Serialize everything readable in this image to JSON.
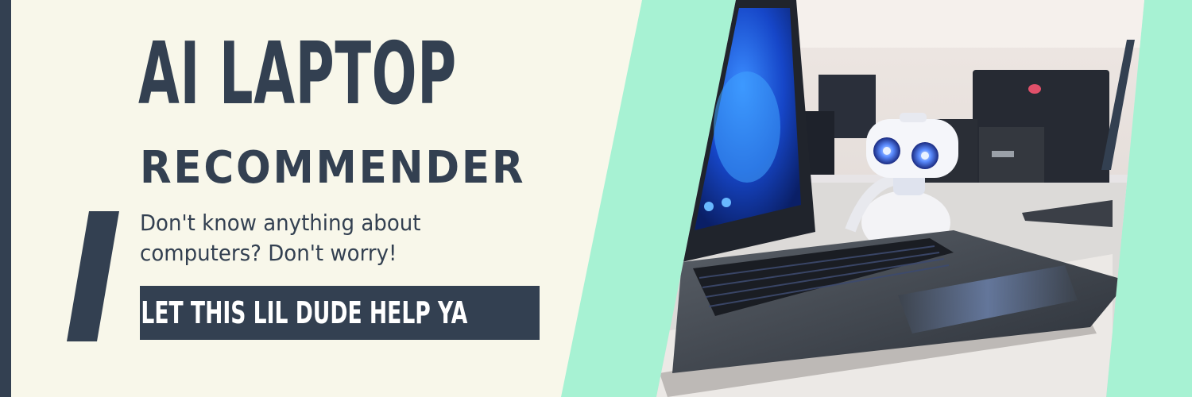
{
  "colors": {
    "cream": "#f8f7ea",
    "navy": "#334051",
    "mint": "#a7f2d3",
    "cta_text": "#ffffff"
  },
  "banner": {
    "title": "AI LAPTOP",
    "subtitle": "RECOMMENDER",
    "tagline_lines": [
      "Don't know anything about",
      "computers? Don't worry!"
    ],
    "cta_label": "LET THIS LIL DUDE HELP YA"
  }
}
